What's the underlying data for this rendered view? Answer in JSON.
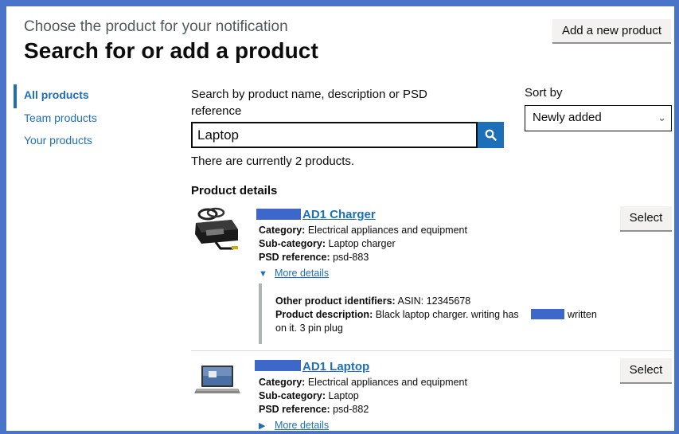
{
  "header": {
    "caption": "Choose the product for your notification",
    "title": "Search for or add a product",
    "add_button": "Add a new product"
  },
  "sidebar": {
    "items": [
      {
        "label": "All products",
        "active": true
      },
      {
        "label": "Team products",
        "active": false
      },
      {
        "label": "Your products",
        "active": false
      }
    ]
  },
  "search": {
    "label": "Search by product name, description or PSD reference",
    "value": "Laptop",
    "button_icon": "search-icon"
  },
  "sort": {
    "label": "Sort by",
    "selected": "Newly added"
  },
  "results": {
    "count_text": "There are currently 2 products.",
    "heading": "Product details"
  },
  "products": [
    {
      "name": "AD1 Charger",
      "category_label": "Category:",
      "category": "Electrical appliances and equipment",
      "subcategory_label": "Sub-category:",
      "subcategory": "Laptop charger",
      "psd_label": "PSD reference:",
      "psd": "psd-883",
      "details_label": "More details",
      "details_expanded": true,
      "identifiers_label": "Other product identifiers:",
      "identifiers": "ASIN: 12345678",
      "description_label": "Product description:",
      "description_before": "Black laptop charger. writing has",
      "description_after": "written",
      "description_line2": "on it. 3 pin plug",
      "select_label": "Select"
    },
    {
      "name": "AD1 Laptop",
      "category_label": "Category:",
      "category": "Electrical appliances and equipment",
      "subcategory_label": "Sub-category:",
      "subcategory": "Laptop",
      "psd_label": "PSD reference:",
      "psd": "psd-882",
      "details_label": "More details",
      "details_expanded": false,
      "select_label": "Select"
    }
  ],
  "colors": {
    "link": "#1d70b8",
    "redaction": "#3d68c9",
    "frame": "#4a74c9"
  }
}
